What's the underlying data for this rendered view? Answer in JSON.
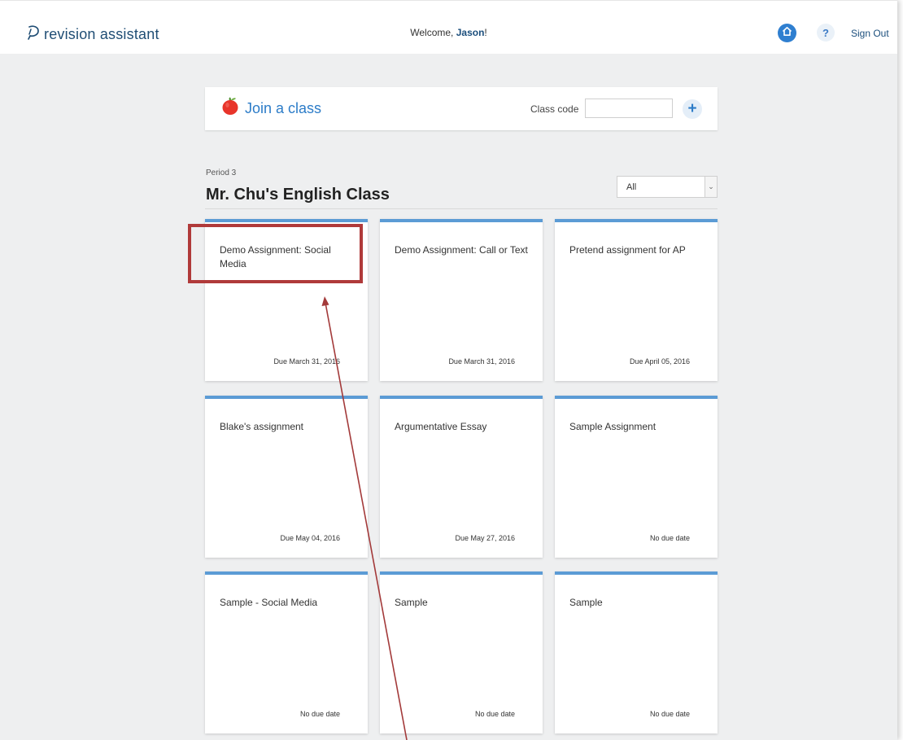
{
  "header": {
    "logo_text": "revision assistant",
    "welcome_prefix": "Welcome, ",
    "user_name": "Jason",
    "welcome_suffix": "!",
    "help_label": "?",
    "sign_out_label": "Sign Out",
    "icons": [
      "logo-icon",
      "home-icon",
      "help-icon"
    ]
  },
  "join": {
    "title": "Join a class",
    "code_label": "Class code",
    "code_value": "",
    "code_placeholder": "",
    "add_label": "+"
  },
  "class": {
    "period": "Period 3",
    "title": "Mr. Chu's English Class",
    "filter_value": "All",
    "filter_arrow": "⌄"
  },
  "assignments": [
    {
      "title": "Demo Assignment: Social Media",
      "due": "Due March 31, 2016"
    },
    {
      "title": "Demo Assignment: Call or Text",
      "due": "Due March 31, 2016"
    },
    {
      "title": "Pretend assignment for AP",
      "due": "Due April 05, 2016"
    },
    {
      "title": "Blake's assignment",
      "due": "Due May 04, 2016"
    },
    {
      "title": "Argumentative Essay",
      "due": "Due May 27, 2016"
    },
    {
      "title": "Sample Assignment",
      "due": "No due date"
    },
    {
      "title": "Sample - Social Media",
      "due": "No due date"
    },
    {
      "title": "Sample",
      "due": "No due date"
    },
    {
      "title": "Sample",
      "due": "No due date"
    }
  ],
  "colors": {
    "background": "#eeeff0",
    "accent_blue": "#2c7cc8",
    "card_top_border": "#5b9bd5",
    "annotation_red": "#b03a3a",
    "brand_navy": "#1f4d74"
  }
}
